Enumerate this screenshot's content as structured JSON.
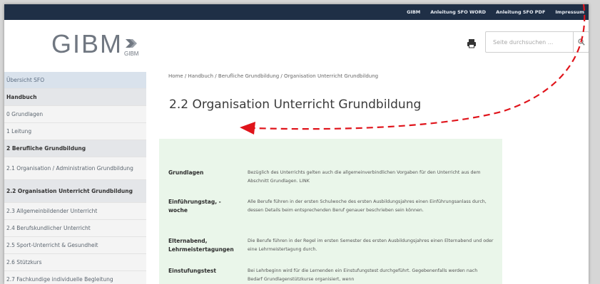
{
  "topnav": {
    "links": [
      "GIBM",
      "Anleitung SFO WORD",
      "Anleitung SFO PDF",
      "Impressum"
    ]
  },
  "header": {
    "logo_text": "GIBM",
    "logo_sub": "GIBM",
    "search_placeholder": "Seite durchsuchen ...",
    "printer_icon": "printer-icon",
    "search_icon": "search-icon"
  },
  "sidebar": {
    "items": [
      {
        "label": "Übersicht SFO",
        "type": "first"
      },
      {
        "label": "Handbuch",
        "type": "section"
      },
      {
        "label": "0  Grundlagen",
        "type": "normal"
      },
      {
        "label": "1  Leitung",
        "type": "normal"
      },
      {
        "label": "2  Berufliche Grundbildung",
        "type": "section"
      },
      {
        "label": "2.1  Organisation / Administration Grundbildung",
        "type": "normal"
      },
      {
        "label": "2.2  Organisation Unterricht Grundbildung",
        "type": "active"
      },
      {
        "label": "2.3  Allgemeinbildender Unterricht",
        "type": "normal"
      },
      {
        "label": "2.4  Berufskundlicher Unterricht",
        "type": "normal"
      },
      {
        "label": "2.5  Sport-Unterricht & Gesundheit",
        "type": "normal"
      },
      {
        "label": "2.6  Stützkurs",
        "type": "normal"
      },
      {
        "label": "2.7  Fachkundige individuelle Begleitung",
        "type": "normal"
      }
    ]
  },
  "content": {
    "breadcrumb": "Home / Handbuch / Berufliche Grundbildung / Organisation Unterricht Grundbildung",
    "title": "2.2 Organisation Unterricht Grundbildung",
    "rows": [
      {
        "label": "Grundlagen",
        "text": "Bezüglich des Unterrichts gelten auch die allgemeinverbindlichen Vorgaben für den Unterricht aus dem Abschnitt Grundlagen. LINK"
      },
      {
        "label": "Einführungstag, -woche",
        "text": "Alle Berufe führen in der ersten Schulwoche des ersten Ausbildungsjahres einen Einführungsanlass durch, dessen Details beim entsprechenden Beruf genauer beschrieben sein können."
      },
      {
        "label": "Elternabend, Lehrmeistertagungen",
        "text": "Die Berufe führen in der Regel im ersten Semester des ersten Ausbildungsjahres einen Elternabend und oder eine Lehrmeistertagung durch."
      },
      {
        "label": "Einstufungstest",
        "text": "Bei Lehrbeginn wird für die Lernenden ein Einstufungstest durchgeführt. Gegebenenfalls werden nach Bedarf Grundlagenstützkurse organisiert, wenn"
      }
    ]
  },
  "colors": {
    "topbar": "#1f2f46",
    "sidebar_bg": "#f4f4f4",
    "infobox_bg": "#eaf6ea",
    "annotation_arrow": "#e0141b"
  }
}
